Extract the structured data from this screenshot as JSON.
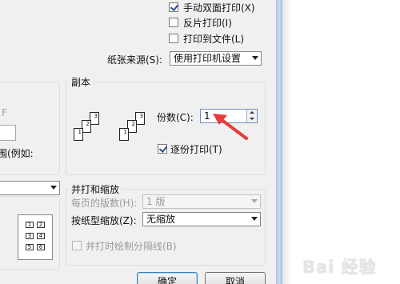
{
  "options": {
    "manual_duplex": "手动双面打印(X)",
    "reverse_print": "反片打印(I)",
    "print_to_file": "打印到文件(L)"
  },
  "paper_source": {
    "label": "纸张来源(S):",
    "value": "使用打印机设置"
  },
  "left_partial": {
    "letter": "F",
    "example_text": "围(例如:"
  },
  "copies": {
    "title": "副本",
    "count_label": "份数(C):",
    "count_value": "1",
    "collate_label": "逐份打印(T)"
  },
  "zoom": {
    "title": "并打和缩放",
    "pages_per_sheet_label": "每页的版数(H):",
    "pages_per_sheet_value": "1 版",
    "scale_to_paper_label": "按纸型缩放(Z):",
    "scale_to_paper_value": "无缩放",
    "draw_borders_label": "并打时绘制分隔线(B)"
  },
  "preview_grid": [
    "1",
    "2",
    "3",
    "4",
    "5",
    "6"
  ],
  "collate_pages_a": [
    "3",
    "2",
    "1"
  ],
  "collate_pages_b": [
    "3",
    "2",
    "1"
  ],
  "buttons": {
    "ok": "确定",
    "cancel": "取消"
  },
  "watermark": "Bai 经验",
  "colors": {
    "annotation_arrow": "#e53c3c",
    "dialog_bg": "#f0f0f0"
  }
}
